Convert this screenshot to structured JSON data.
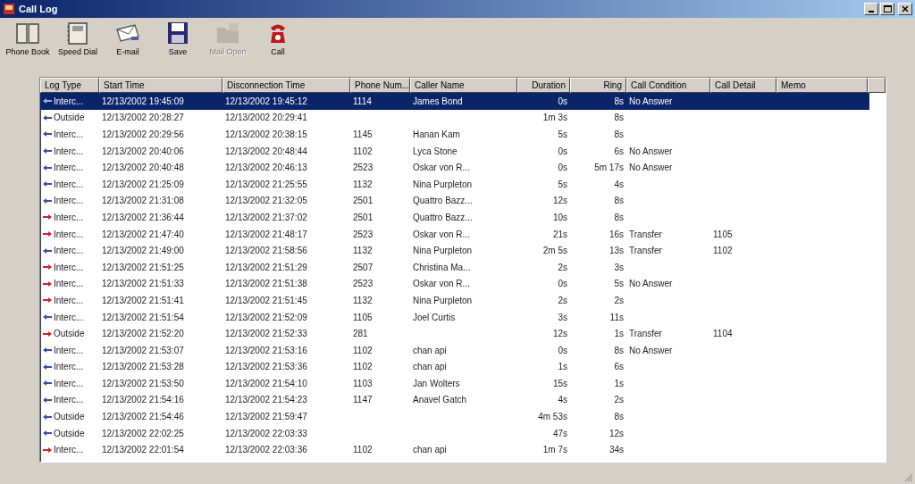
{
  "window": {
    "title": "Call Log"
  },
  "toolbar": [
    {
      "label": "Phone Book",
      "kind": "book",
      "disabled": false
    },
    {
      "label": "Speed Dial",
      "kind": "speeddial",
      "disabled": false
    },
    {
      "label": "E-mail",
      "kind": "email",
      "disabled": false
    },
    {
      "label": "Save",
      "kind": "save",
      "disabled": false
    },
    {
      "label": "Mail Open",
      "kind": "folder",
      "disabled": true
    },
    {
      "label": "Call",
      "kind": "phone",
      "disabled": false
    }
  ],
  "table": {
    "columns": [
      {
        "label": "Log Type"
      },
      {
        "label": "Start Time"
      },
      {
        "label": "Disconnection Time"
      },
      {
        "label": "Phone Num..."
      },
      {
        "label": "Caller Name"
      },
      {
        "label": "Duration"
      },
      {
        "label": "Ring"
      },
      {
        "label": "Call Condition"
      },
      {
        "label": "Call Detail"
      },
      {
        "label": "Memo"
      }
    ],
    "rows": [
      {
        "kind": "incoming",
        "selected": true,
        "cells": [
          "Interc...",
          "12/13/2002 19:45:09",
          "12/13/2002 19:45:12",
          "1114",
          "James Bond",
          "0s",
          "8s",
          "No Answer",
          "",
          ""
        ]
      },
      {
        "kind": "incoming",
        "selected": false,
        "cells": [
          "Outside",
          "12/13/2002 20:28:27",
          "12/13/2002 20:29:41",
          "",
          "",
          "1m 3s",
          "8s",
          "",
          "",
          ""
        ]
      },
      {
        "kind": "incoming",
        "selected": false,
        "cells": [
          "Interc...",
          "12/13/2002 20:29:56",
          "12/13/2002 20:38:15",
          "1145",
          "Hanan Kam",
          "5s",
          "8s",
          "",
          "",
          ""
        ]
      },
      {
        "kind": "incoming",
        "selected": false,
        "cells": [
          "Interc...",
          "12/13/2002 20:40:06",
          "12/13/2002 20:48:44",
          "1102",
          "Lyca Stone",
          "0s",
          "6s",
          "No Answer",
          "",
          ""
        ]
      },
      {
        "kind": "incoming",
        "selected": false,
        "cells": [
          "Interc...",
          "12/13/2002 20:40:48",
          "12/13/2002 20:46:13",
          "2523",
          "Oskar von R...",
          "0s",
          "5m 17s",
          "No Answer",
          "",
          ""
        ]
      },
      {
        "kind": "incoming",
        "selected": false,
        "cells": [
          "Interc...",
          "12/13/2002 21:25:09",
          "12/13/2002 21:25:55",
          "1132",
          "Nina Purpleton",
          "5s",
          "4s",
          "",
          "",
          ""
        ]
      },
      {
        "kind": "incoming",
        "selected": false,
        "cells": [
          "Interc...",
          "12/13/2002 21:31:08",
          "12/13/2002 21:32:05",
          "2501",
          "Quattro Bazz...",
          "12s",
          "8s",
          "",
          "",
          ""
        ]
      },
      {
        "kind": "outgoing",
        "selected": false,
        "cells": [
          "Interc...",
          "12/13/2002 21:36:44",
          "12/13/2002 21:37:02",
          "2501",
          "Quattro Bazz...",
          "10s",
          "8s",
          "",
          "",
          ""
        ]
      },
      {
        "kind": "outgoing",
        "selected": false,
        "cells": [
          "Interc...",
          "12/13/2002 21:47:40",
          "12/13/2002 21:48:17",
          "2523",
          "Oskar von R...",
          "21s",
          "16s",
          "Transfer",
          "1105",
          ""
        ]
      },
      {
        "kind": "incoming",
        "selected": false,
        "cells": [
          "Interc...",
          "12/13/2002 21:49:00",
          "12/13/2002 21:58:56",
          "1132",
          "Nina Purpleton",
          "2m 5s",
          "13s",
          "Transfer",
          "1102",
          ""
        ]
      },
      {
        "kind": "outgoing",
        "selected": false,
        "cells": [
          "Interc...",
          "12/13/2002 21:51:25",
          "12/13/2002 21:51:29",
          "2507",
          "Christina Ma...",
          "2s",
          "3s",
          "",
          "",
          ""
        ]
      },
      {
        "kind": "outgoing",
        "selected": false,
        "cells": [
          "Interc...",
          "12/13/2002 21:51:33",
          "12/13/2002 21:51:38",
          "2523",
          "Oskar von R...",
          "0s",
          "5s",
          "No Answer",
          "",
          ""
        ]
      },
      {
        "kind": "outgoing",
        "selected": false,
        "cells": [
          "Interc...",
          "12/13/2002 21:51:41",
          "12/13/2002 21:51:45",
          "1132",
          "Nina Purpleton",
          "2s",
          "2s",
          "",
          "",
          ""
        ]
      },
      {
        "kind": "incoming",
        "selected": false,
        "cells": [
          "Interc...",
          "12/13/2002 21:51:54",
          "12/13/2002 21:52:09",
          "1105",
          "Joel Curtis",
          "3s",
          "11s",
          "",
          "",
          ""
        ]
      },
      {
        "kind": "outgoing",
        "selected": false,
        "cells": [
          "Outside",
          "12/13/2002 21:52:20",
          "12/13/2002 21:52:33",
          "281",
          "",
          "12s",
          "1s",
          "Transfer",
          "1104",
          ""
        ]
      },
      {
        "kind": "incoming",
        "selected": false,
        "cells": [
          "Interc...",
          "12/13/2002 21:53:07",
          "12/13/2002 21:53:16",
          "1102",
          "chan api",
          "0s",
          "8s",
          "No Answer",
          "",
          ""
        ]
      },
      {
        "kind": "incoming",
        "selected": false,
        "cells": [
          "Interc...",
          "12/13/2002 21:53:28",
          "12/13/2002 21:53:36",
          "1102",
          "chan api",
          "1s",
          "6s",
          "",
          "",
          ""
        ]
      },
      {
        "kind": "incoming",
        "selected": false,
        "cells": [
          "Interc...",
          "12/13/2002 21:53:50",
          "12/13/2002 21:54:10",
          "1103",
          "Jan Wolters",
          "15s",
          "1s",
          "",
          "",
          ""
        ]
      },
      {
        "kind": "incoming",
        "selected": false,
        "cells": [
          "Interc...",
          "12/13/2002 21:54:16",
          "12/13/2002 21:54:23",
          "1147",
          "Anavel Gatch",
          "4s",
          "2s",
          "",
          "",
          ""
        ]
      },
      {
        "kind": "incoming",
        "selected": false,
        "cells": [
          "Outside",
          "12/13/2002 21:54:46",
          "12/13/2002 21:59:47",
          "",
          "",
          "4m 53s",
          "8s",
          "",
          "",
          ""
        ]
      },
      {
        "kind": "incoming",
        "selected": false,
        "cells": [
          "Outside",
          "12/13/2002 22:02:25",
          "12/13/2002 22:03:33",
          "",
          "",
          "47s",
          "12s",
          "",
          "",
          ""
        ]
      },
      {
        "kind": "outgoing",
        "selected": false,
        "cells": [
          "Interc...",
          "12/13/2002 22:01:54",
          "12/13/2002 22:03:36",
          "1102",
          "chan api",
          "1m 7s",
          "34s",
          "",
          "",
          ""
        ]
      }
    ]
  }
}
